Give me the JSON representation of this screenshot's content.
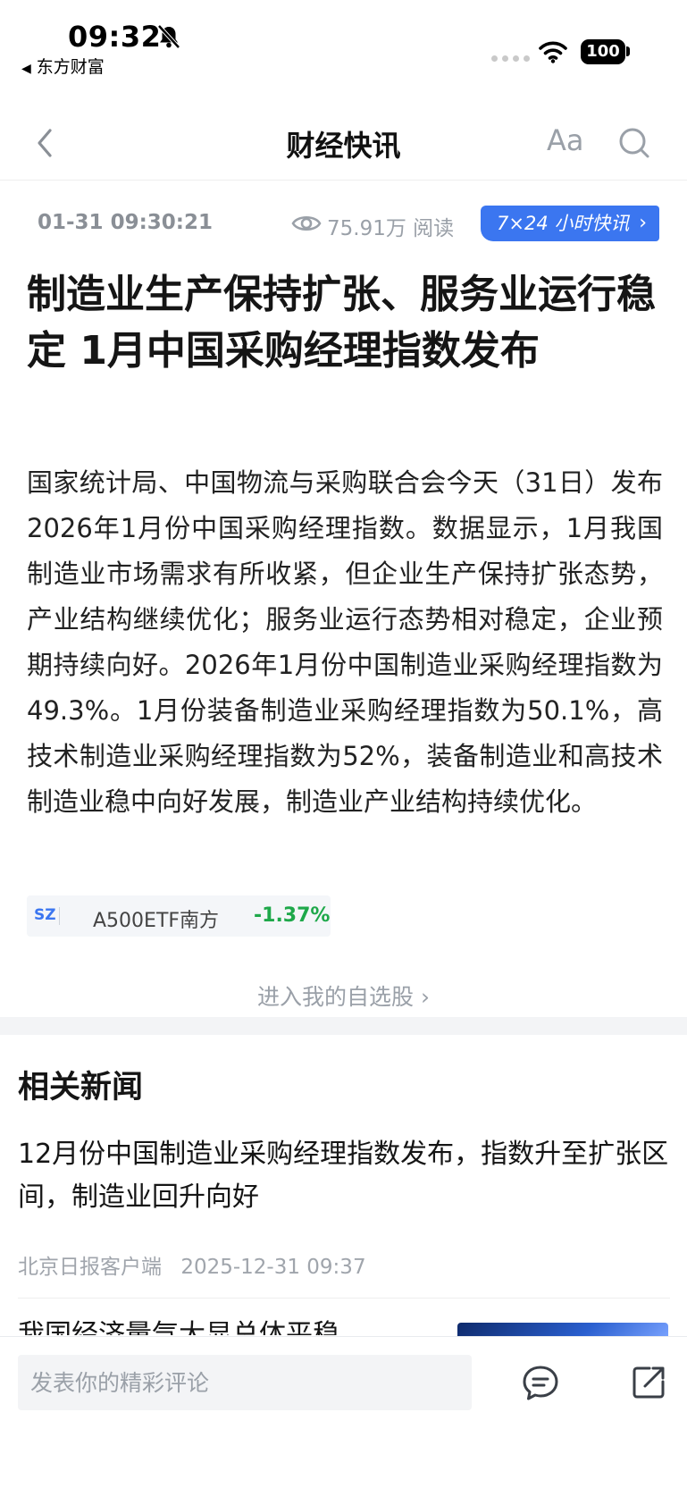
{
  "status_bar": {
    "time": "09:32",
    "back_app": "东方财富",
    "battery": "100",
    "icons": [
      "bell-off-icon",
      "wifi-icon",
      "battery-icon"
    ]
  },
  "nav": {
    "title": "财经快讯",
    "font_button": "Aa",
    "icons": [
      "back-chevron-icon",
      "search-icon"
    ]
  },
  "meta": {
    "date": "01-31 09:30:21",
    "views": "75.91万 阅读",
    "tag": "7×24 小时快讯",
    "tag_color": "#3b76f0"
  },
  "article": {
    "headline": "制造业生产保持扩张、服务业运行稳定 1月中国采购经理指数发布",
    "body": "国家统计局、中国物流与采购联合会今天（31日）发布2026年1月份中国采购经理指数。数据显示，1月我国制造业市场需求有所收紧，但企业生产保持扩张态势，产业结构继续优化；服务业运行态势相对稳定，企业预期持续向好。2026年1月份中国制造业采购经理指数为49.3%。1月份装备制造业采购经理指数为50.1%，高技术制造业采购经理指数为52%，装备制造业和高技术制造业稳中向好发展，制造业产业结构持续优化。"
  },
  "stock": {
    "market": "SZ",
    "name": "A500ETF南方",
    "change": "-1.37%",
    "change_color": "#1ea84a"
  },
  "watch_link": "进入我的自选股",
  "related": {
    "title": "相关新闻",
    "items": [
      {
        "title": "12月份中国制造业采购经理指数发布，指数升至扩张区间，制造业回升向好",
        "source": "北京日报客户端",
        "time": "2025-12-31 09:37"
      },
      {
        "title": "我国经济量气大显总体平稳"
      }
    ]
  },
  "bottom_bar": {
    "comment_placeholder": "发表你的精彩评论",
    "icons": [
      "comment-icon",
      "share-icon"
    ]
  }
}
